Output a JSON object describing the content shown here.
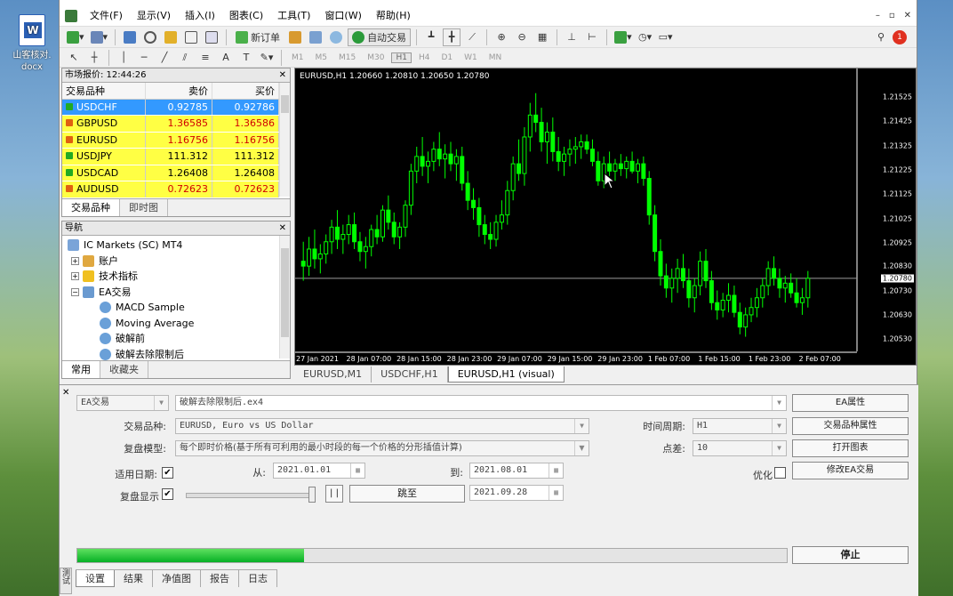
{
  "desktop": {
    "icon_label": "山客核对. docx"
  },
  "menu": [
    "文件(F)",
    "显示(V)",
    "插入(I)",
    "图表(C)",
    "工具(T)",
    "窗口(W)",
    "帮助(H)"
  ],
  "toolbar": {
    "new_order": "新订单",
    "auto_trade": "自动交易",
    "alert_count": "1"
  },
  "timeframes": [
    "M1",
    "M5",
    "M15",
    "M30",
    "H1",
    "H4",
    "D1",
    "W1",
    "MN"
  ],
  "market_watch": {
    "title": "市场报价: 12:44:26",
    "cols": [
      "交易品种",
      "卖价",
      "买价"
    ],
    "rows": [
      {
        "symbol": "USDCHF",
        "bid": "0.92785",
        "ask": "0.92786"
      },
      {
        "symbol": "GBPUSD",
        "bid": "1.36585",
        "ask": "1.36586"
      },
      {
        "symbol": "EURUSD",
        "bid": "1.16756",
        "ask": "1.16756"
      },
      {
        "symbol": "USDJPY",
        "bid": "111.312",
        "ask": "111.312"
      },
      {
        "symbol": "USDCAD",
        "bid": "1.26408",
        "ask": "1.26408"
      },
      {
        "symbol": "AUDUSD",
        "bid": "0.72623",
        "ask": "0.72623"
      }
    ],
    "tabs": [
      "交易品种",
      "即时图"
    ]
  },
  "navigator": {
    "title": "导航",
    "items": [
      "IC Markets (SC) MT4",
      "账户",
      "技术指标",
      "EA交易",
      "MACD Sample",
      "Moving Average",
      "破解前",
      "破解去除限制后"
    ],
    "tabs": [
      "常用",
      "收藏夹"
    ]
  },
  "chart": {
    "title": "EURUSD,H1  1.20660 1.20810 1.20650 1.20780",
    "y_labels": [
      "1.21525",
      "1.21425",
      "1.21325",
      "1.21225",
      "1.21125",
      "1.21025",
      "1.20925",
      "1.20830",
      "1.20730",
      "1.20630",
      "1.20530"
    ],
    "last_price": "1.20780",
    "x_labels": [
      "27 Jan 2021",
      "28 Jan 07:00",
      "28 Jan 15:00",
      "28 Jan 23:00",
      "29 Jan 07:00",
      "29 Jan 15:00",
      "29 Jan 23:00",
      "1 Feb 07:00",
      "1 Feb 15:00",
      "1 Feb 23:00",
      "2 Feb 07:00"
    ],
    "tabs": [
      "EURUSD,M1",
      "USDCHF,H1",
      "EURUSD,H1 (visual)"
    ]
  },
  "chart_data": {
    "type": "candlestick",
    "ylim": [
      1.2048,
      1.2159
    ],
    "candles": [
      [
        1.2085,
        1.2093,
        1.2077,
        1.2083
      ],
      [
        1.2083,
        1.2095,
        1.2079,
        1.209
      ],
      [
        1.209,
        1.2098,
        1.2082,
        1.2086
      ],
      [
        1.2086,
        1.2092,
        1.208,
        1.2088
      ],
      [
        1.2088,
        1.2096,
        1.2084,
        1.2093
      ],
      [
        1.2093,
        1.2102,
        1.2088,
        1.2099
      ],
      [
        1.2099,
        1.2106,
        1.209,
        1.2094
      ],
      [
        1.2094,
        1.21,
        1.2088,
        1.2096
      ],
      [
        1.2096,
        1.2104,
        1.2092,
        1.21
      ],
      [
        1.21,
        1.2105,
        1.209,
        1.2093
      ],
      [
        1.2093,
        1.2097,
        1.2085,
        1.2089
      ],
      [
        1.2089,
        1.2095,
        1.2082,
        1.2091
      ],
      [
        1.2091,
        1.21,
        1.2087,
        1.2098
      ],
      [
        1.2098,
        1.2104,
        1.2092,
        1.2095
      ],
      [
        1.2095,
        1.2108,
        1.2093,
        1.2106
      ],
      [
        1.2106,
        1.2112,
        1.2098,
        1.2101
      ],
      [
        1.2101,
        1.2105,
        1.2092,
        1.2095
      ],
      [
        1.2095,
        1.2101,
        1.209,
        1.2099
      ],
      [
        1.2099,
        1.211,
        1.2095,
        1.2108
      ],
      [
        1.2108,
        1.2125,
        1.2104,
        1.2122
      ],
      [
        1.2122,
        1.2132,
        1.2117,
        1.2128
      ],
      [
        1.2128,
        1.2136,
        1.212,
        1.2124
      ],
      [
        1.2124,
        1.213,
        1.2117,
        1.2126
      ],
      [
        1.2126,
        1.2134,
        1.2122,
        1.2131
      ],
      [
        1.2131,
        1.2138,
        1.2124,
        1.2127
      ],
      [
        1.2127,
        1.2133,
        1.2119,
        1.2129
      ],
      [
        1.2129,
        1.2134,
        1.2122,
        1.2125
      ],
      [
        1.2125,
        1.2131,
        1.2118,
        1.2128
      ],
      [
        1.2128,
        1.2132,
        1.2114,
        1.2117
      ],
      [
        1.2117,
        1.2122,
        1.2106,
        1.211
      ],
      [
        1.211,
        1.2115,
        1.2102,
        1.2107
      ],
      [
        1.2107,
        1.2111,
        1.2095,
        1.21
      ],
      [
        1.21,
        1.2104,
        1.2092,
        1.2096
      ],
      [
        1.2096,
        1.2101,
        1.209,
        1.2094
      ],
      [
        1.2094,
        1.2104,
        1.2091,
        1.2101
      ],
      [
        1.2101,
        1.211,
        1.2098,
        1.2104
      ],
      [
        1.2104,
        1.2118,
        1.21,
        1.2114
      ],
      [
        1.2114,
        1.2128,
        1.211,
        1.2125
      ],
      [
        1.2125,
        1.2135,
        1.2118,
        1.2121
      ],
      [
        1.2121,
        1.214,
        1.2116,
        1.2136
      ],
      [
        1.2136,
        1.215,
        1.213,
        1.2145
      ],
      [
        1.2145,
        1.2154,
        1.2138,
        1.2142
      ],
      [
        1.2142,
        1.2148,
        1.213,
        1.2134
      ],
      [
        1.2134,
        1.2142,
        1.2125,
        1.2138
      ],
      [
        1.2138,
        1.2144,
        1.2126,
        1.213
      ],
      [
        1.213,
        1.2136,
        1.2122,
        1.2126
      ],
      [
        1.2126,
        1.2132,
        1.212,
        1.2129
      ],
      [
        1.2129,
        1.2135,
        1.2124,
        1.2131
      ],
      [
        1.2131,
        1.2136,
        1.2125,
        1.2132
      ],
      [
        1.2132,
        1.2137,
        1.2127,
        1.2134
      ],
      [
        1.2134,
        1.2137,
        1.2129,
        1.2131
      ],
      [
        1.2131,
        1.2135,
        1.2124,
        1.2126
      ],
      [
        1.2126,
        1.213,
        1.2116,
        1.2118
      ],
      [
        1.2118,
        1.2128,
        1.2115,
        1.2125
      ],
      [
        1.2125,
        1.213,
        1.212,
        1.2122
      ],
      [
        1.2122,
        1.2127,
        1.2118,
        1.2125
      ],
      [
        1.2125,
        1.2129,
        1.212,
        1.2123
      ],
      [
        1.2123,
        1.2128,
        1.2119,
        1.2126
      ],
      [
        1.2126,
        1.213,
        1.2121,
        1.2122
      ],
      [
        1.2122,
        1.2127,
        1.2117,
        1.2125
      ],
      [
        1.2125,
        1.2128,
        1.2116,
        1.2119
      ],
      [
        1.2119,
        1.2122,
        1.21,
        1.2104
      ],
      [
        1.2104,
        1.2108,
        1.2085,
        1.2089
      ],
      [
        1.2089,
        1.2094,
        1.2075,
        1.2079
      ],
      [
        1.2079,
        1.2084,
        1.207,
        1.2074
      ],
      [
        1.2074,
        1.2082,
        1.2068,
        1.2078
      ],
      [
        1.2078,
        1.2086,
        1.2072,
        1.2082
      ],
      [
        1.2082,
        1.2088,
        1.2074,
        1.2077
      ],
      [
        1.2077,
        1.2082,
        1.2066,
        1.207
      ],
      [
        1.207,
        1.2078,
        1.2064,
        1.2075
      ],
      [
        1.2075,
        1.2089,
        1.2071,
        1.2085
      ],
      [
        1.2085,
        1.209,
        1.2074,
        1.2077
      ],
      [
        1.2077,
        1.2081,
        1.2065,
        1.2068
      ],
      [
        1.2068,
        1.2073,
        1.2061,
        1.2065
      ],
      [
        1.2065,
        1.2072,
        1.2062,
        1.2069
      ],
      [
        1.2069,
        1.2076,
        1.2064,
        1.2071
      ],
      [
        1.2071,
        1.2075,
        1.2062,
        1.2064
      ],
      [
        1.2064,
        1.2068,
        1.2055,
        1.2058
      ],
      [
        1.2058,
        1.2066,
        1.2054,
        1.2063
      ],
      [
        1.2063,
        1.207,
        1.206,
        1.2066
      ],
      [
        1.2066,
        1.2074,
        1.2062,
        1.207
      ],
      [
        1.207,
        1.2078,
        1.2066,
        1.2075
      ],
      [
        1.2075,
        1.2085,
        1.2071,
        1.2082
      ],
      [
        1.2082,
        1.2087,
        1.2075,
        1.2078
      ],
      [
        1.2078,
        1.2082,
        1.207,
        1.2074
      ],
      [
        1.2074,
        1.2079,
        1.2068,
        1.2076
      ],
      [
        1.2076,
        1.208,
        1.207,
        1.2072
      ],
      [
        1.2072,
        1.2078,
        1.2066,
        1.2068
      ],
      [
        1.2068,
        1.2074,
        1.2063,
        1.207
      ],
      [
        1.207,
        1.2081,
        1.2066,
        1.2078
      ]
    ]
  },
  "tester": {
    "mode": "EA交易",
    "ea": "破解去除限制后.ex4",
    "symbol_label": "交易品种:",
    "symbol": "EURUSD, Euro vs US Dollar",
    "model_label": "复盘模型:",
    "model": "每个即时价格(基于所有可利用的最小时段的每一个价格的分形插值计算)",
    "use_date_label": "适用日期:",
    "from_label": "从:",
    "from": "2021.01.01",
    "to_label": "到:",
    "to": "2021.08.01",
    "visual_label": "复盘显示",
    "skip_to": "跳至",
    "skip_date": "2021.09.28",
    "period_label": "时间周期:",
    "period": "H1",
    "spread_label": "点差:",
    "spread": "10",
    "optimize_label": "优化",
    "buttons": {
      "ea_props": "EA属性",
      "symbol_props": "交易品种属性",
      "open_chart": "打开图表",
      "modify_ea": "修改EA交易",
      "stop": "停止"
    },
    "pause": "| |",
    "progress": 0.32,
    "tabs": [
      "设置",
      "结果",
      "净值图",
      "报告",
      "日志"
    ],
    "side_label": "测试"
  },
  "colors": {
    "bull": "#00ff00",
    "bear": "#00ff00",
    "selected": "#3399ff",
    "quote_bg": "#ffff44",
    "progress": "#06b025"
  }
}
